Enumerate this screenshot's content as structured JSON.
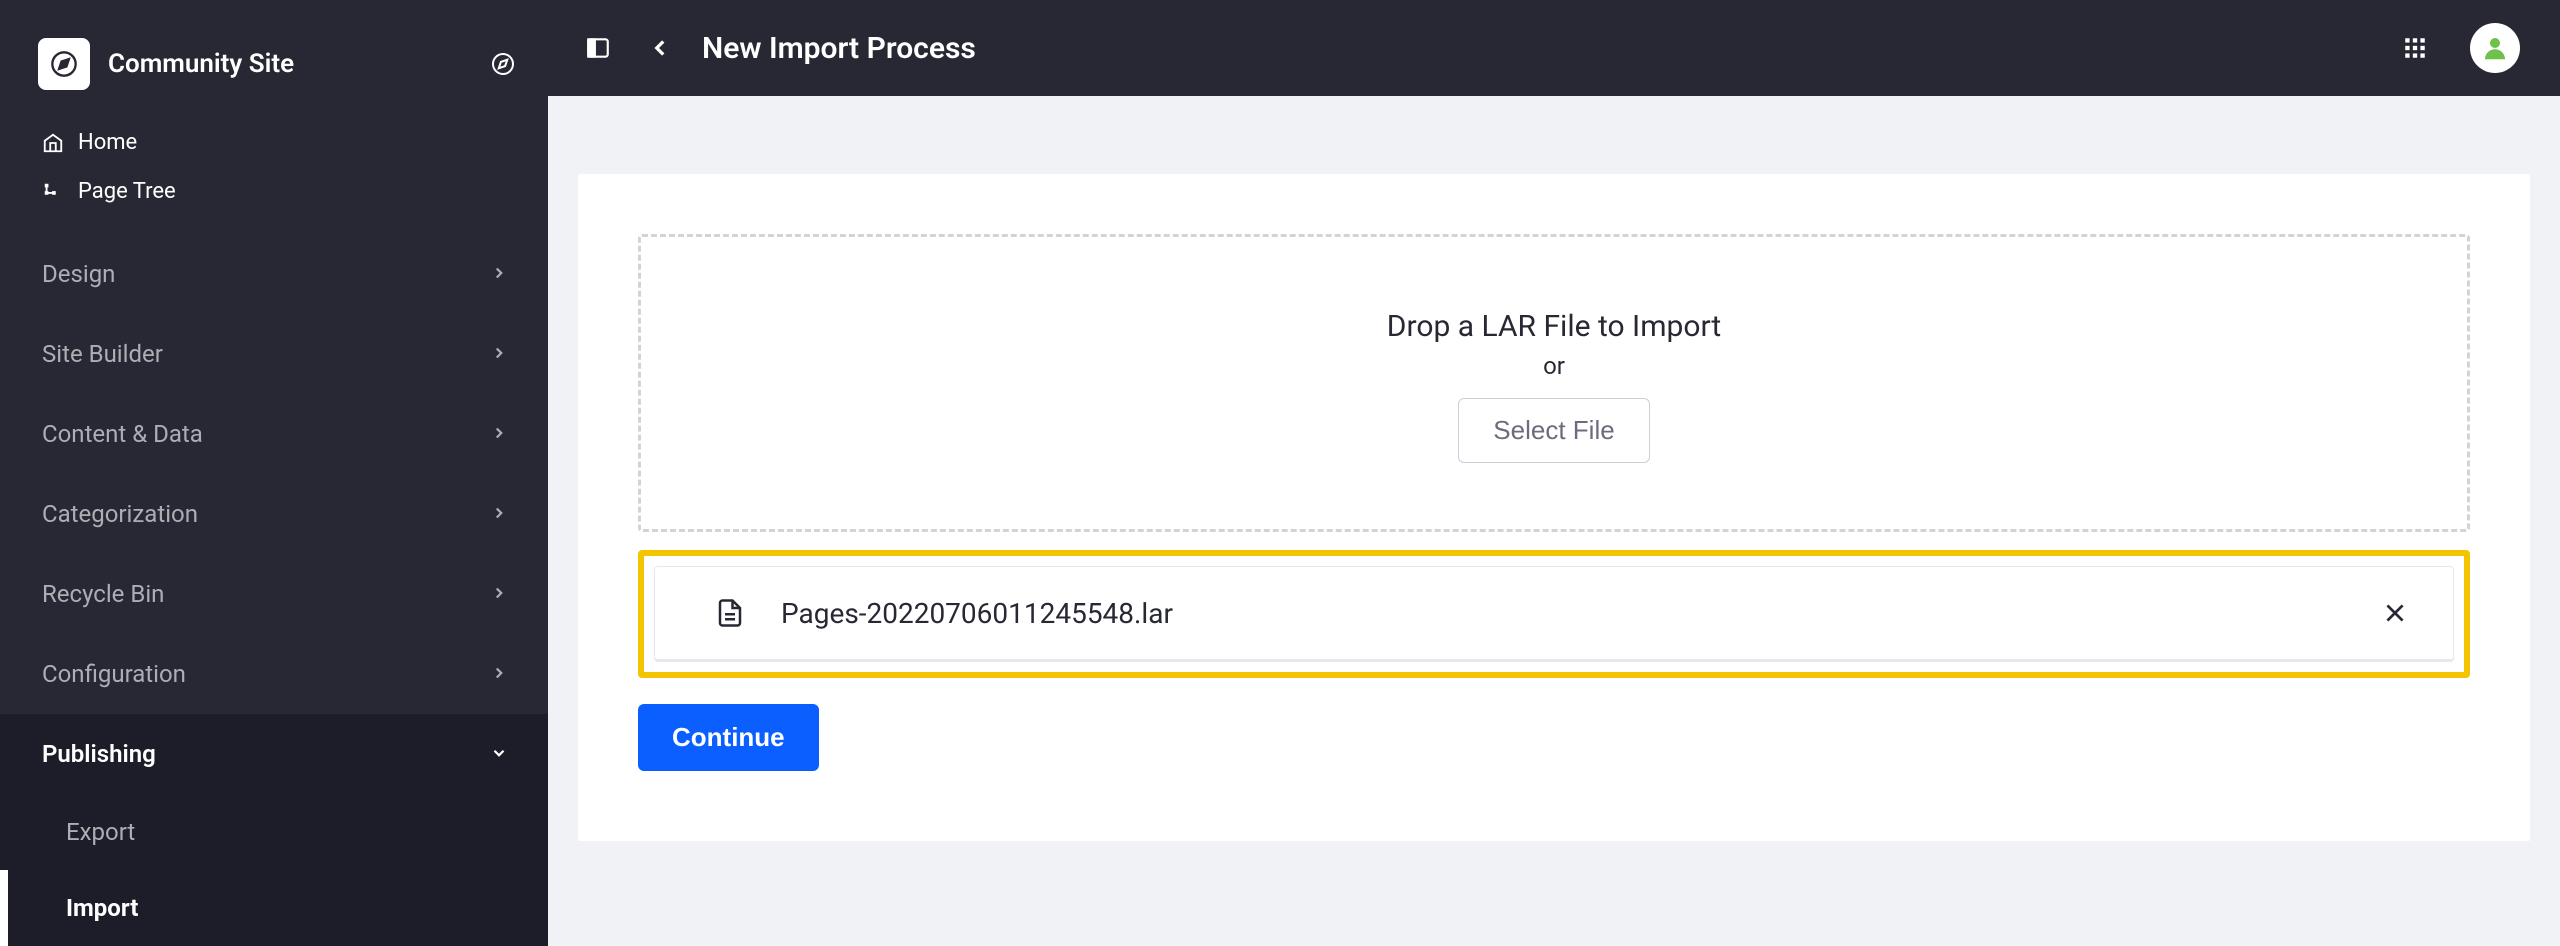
{
  "sidebar": {
    "site_name": "Community Site",
    "top_links": {
      "home": "Home",
      "page_tree": "Page Tree"
    },
    "sections": {
      "design": "Design",
      "site_builder": "Site Builder",
      "content_data": "Content & Data",
      "categorization": "Categorization",
      "recycle_bin": "Recycle Bin",
      "configuration": "Configuration",
      "publishing": "Publishing"
    },
    "publishing_sub": {
      "export": "Export",
      "import": "Import"
    }
  },
  "topbar": {
    "title": "New Import Process"
  },
  "dropzone": {
    "title": "Drop a LAR File to Import",
    "or": "or",
    "select_label": "Select File"
  },
  "file": {
    "name": "Pages-20220706011245548.lar"
  },
  "buttons": {
    "continue": "Continue"
  },
  "colors": {
    "accent": "#0b5fff",
    "highlight": "#f2c500"
  }
}
